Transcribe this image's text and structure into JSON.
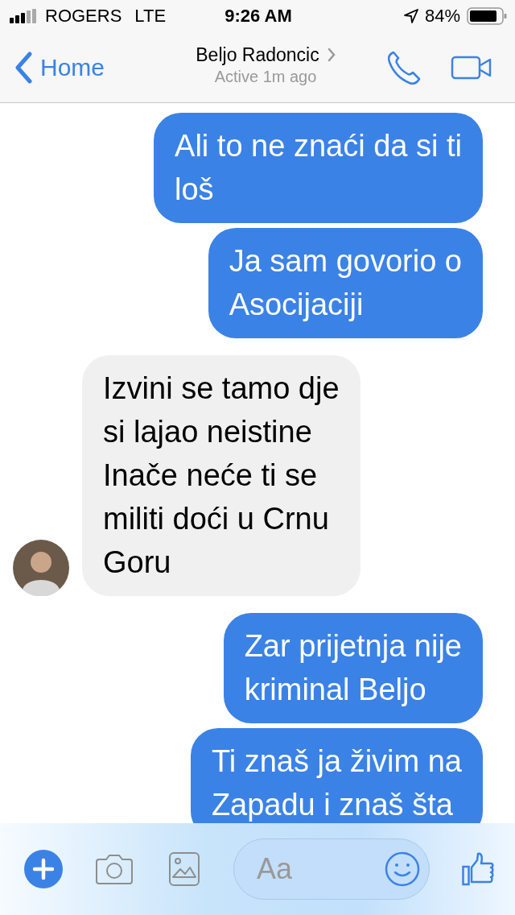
{
  "status_bar": {
    "carrier": "ROGERS",
    "network": "LTE",
    "time": "9:26 AM",
    "battery": "84%"
  },
  "header": {
    "back_label": "Home",
    "contact_name": "Beljo Radoncic",
    "presence": "Active 1m ago"
  },
  "messages": [
    {
      "kind": "outgoing",
      "text": "Ali to ne znaći da si ti\nloš"
    },
    {
      "kind": "outgoing",
      "text": "Ja sam govorio o\nAsocijaciji"
    },
    {
      "kind": "incoming",
      "text": "Izvini se tamo dje\nsi lajao neistine\nInače neće ti se\nmiliti doći u Crnu\nGoru"
    },
    {
      "kind": "outgoing",
      "text": "Zar prijetnja nije\nkriminal Beljo"
    },
    {
      "kind": "outgoing",
      "text": "Ti znaš ja živim na\nZapadu i znaš šta"
    }
  ],
  "composer": {
    "placeholder": "Aa"
  }
}
